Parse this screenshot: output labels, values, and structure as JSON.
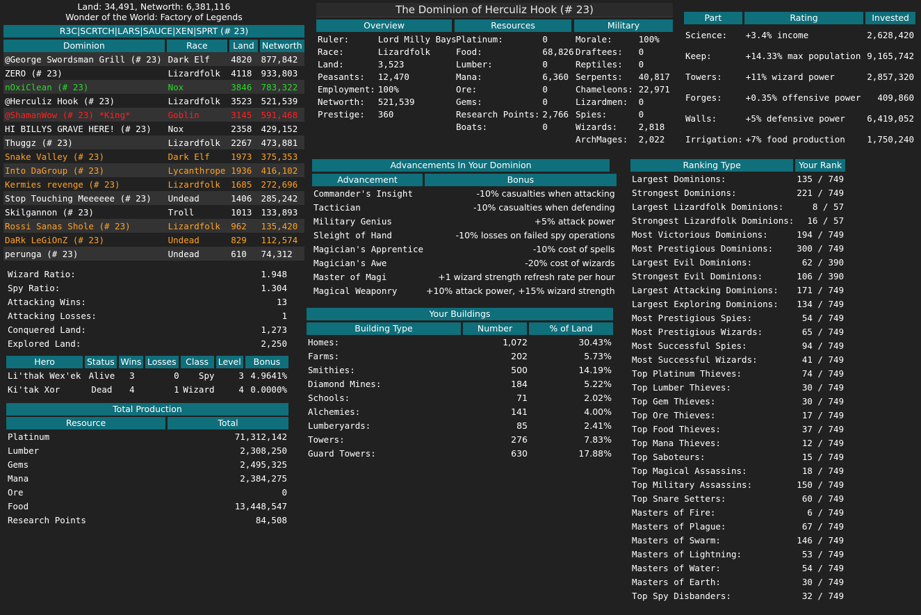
{
  "top": {
    "land_line": "Land: 34,491, Networth: 6,381,116",
    "wonder_line": "Wonder of the World: Factory of Legends"
  },
  "realm": {
    "title": "R3C|SCRTCH|LARS|SAUCE|XEN|SPRT (# 23)",
    "columns": [
      "Dominion",
      "Race",
      "Land",
      "Networth"
    ],
    "rows": [
      {
        "name": "@George Swordsman Grill  (# 23)",
        "race": "Dark Elf",
        "land": "4820",
        "networth": "877,842",
        "color": "white"
      },
      {
        "name": "ZERO  (# 23)",
        "race": "Lizardfolk",
        "land": "4118",
        "networth": "933,803",
        "color": "white"
      },
      {
        "name": "nOxiClean  (# 23)",
        "race": "Nox",
        "land": "3846",
        "networth": "783,322",
        "color": "green"
      },
      {
        "name": "@Herculiz Hook  (# 23)",
        "race": "Lizardfolk",
        "land": "3523",
        "networth": "521,539",
        "color": "white"
      },
      {
        "name": "@ShamanWow  (# 23) *King*",
        "race": "Goblin",
        "land": "3145",
        "networth": "591,468",
        "color": "red"
      },
      {
        "name": "HI BILLYS GRAVE HERE!  (# 23)",
        "race": "Nox",
        "land": "2358",
        "networth": "429,152",
        "color": "white"
      },
      {
        "name": "Thuggz  (# 23)",
        "race": "Lizardfolk",
        "land": "2267",
        "networth": "473,881",
        "color": "white"
      },
      {
        "name": "Snake Valley  (# 23)",
        "race": "Dark Elf",
        "land": "1973",
        "networth": "375,353",
        "color": "orange"
      },
      {
        "name": "Into DaGroup  (# 23)",
        "race": "Lycanthrope",
        "land": "1936",
        "networth": "416,102",
        "color": "orange"
      },
      {
        "name": "Kermies revenge  (# 23)",
        "race": "Lizardfolk",
        "land": "1685",
        "networth": "272,696",
        "color": "orange"
      },
      {
        "name": "Stop Touching Meeeeee  (# 23)",
        "race": "Undead",
        "land": "1406",
        "networth": "285,242",
        "color": "white"
      },
      {
        "name": "Skilgannon  (# 23)",
        "race": "Troll",
        "land": "1013",
        "networth": "133,893",
        "color": "white"
      },
      {
        "name": "Rossi Sanas Shole  (# 23)",
        "race": "Lizardfolk",
        "land": "962",
        "networth": "135,420",
        "color": "orange"
      },
      {
        "name": "DaRk LeGiOnZ  (# 23)",
        "race": "Undead",
        "land": "829",
        "networth": "112,574",
        "color": "orange"
      },
      {
        "name": "perunga  (# 23)",
        "race": "Undead",
        "land": "610",
        "networth": "74,312",
        "color": "white"
      }
    ]
  },
  "ratios": [
    {
      "label": "Wizard Ratio:",
      "value": "1.948"
    },
    {
      "label": "Spy Ratio:",
      "value": "1.304"
    },
    {
      "label": "Attacking Wins:",
      "value": "13"
    },
    {
      "label": "Attacking Losses:",
      "value": "1"
    },
    {
      "label": "Conquered Land:",
      "value": "1,273"
    },
    {
      "label": "Explored Land:",
      "value": "2,250"
    }
  ],
  "heroes": {
    "columns": [
      "Hero",
      "Status",
      "Wins",
      "Losses",
      "Class",
      "Level",
      "Bonus"
    ],
    "rows": [
      {
        "hero": "Li'thak Wex'ek",
        "status": "Alive",
        "wins": "3",
        "losses": "0",
        "class": "Spy",
        "level": "3",
        "bonus": "4.9641%"
      },
      {
        "hero": "Ki'tak Xor",
        "status": "Dead",
        "wins": "4",
        "losses": "1",
        "class": "Wizard",
        "level": "4",
        "bonus": "0.0000%"
      }
    ]
  },
  "production": {
    "title": "Total Production",
    "columns": [
      "Resource",
      "Total"
    ],
    "rows": [
      {
        "resource": "Platinum",
        "total": "71,312,142"
      },
      {
        "resource": "Lumber",
        "total": "2,308,250"
      },
      {
        "resource": "Gems",
        "total": "2,495,325"
      },
      {
        "resource": "Mana",
        "total": "2,384,275"
      },
      {
        "resource": "Ore",
        "total": "0"
      },
      {
        "resource": "Food",
        "total": "13,448,547"
      },
      {
        "resource": "Research Points",
        "total": "84,508"
      }
    ]
  },
  "dominion": {
    "title": "The Dominion of Herculiz Hook (# 23)",
    "overview_label": "Overview",
    "resources_label": "Resources",
    "military_label": "Military",
    "overview": [
      {
        "label": "Ruler:",
        "value": "Lord Milly Bays"
      },
      {
        "label": "Race:",
        "value": "Lizardfolk"
      },
      {
        "label": "Land:",
        "value": "3,523"
      },
      {
        "label": "Peasants:",
        "value": "12,470"
      },
      {
        "label": "Employment:",
        "value": "100%"
      },
      {
        "label": "Networth:",
        "value": "521,539"
      },
      {
        "label": "Prestige:",
        "value": "360"
      }
    ],
    "resources": [
      {
        "label": "Platinum:",
        "value": "0"
      },
      {
        "label": "Food:",
        "value": "68,826"
      },
      {
        "label": "Lumber:",
        "value": "0"
      },
      {
        "label": "Mana:",
        "value": "6,360"
      },
      {
        "label": "Ore:",
        "value": "0"
      },
      {
        "label": "Gems:",
        "value": "0"
      },
      {
        "label": "Research Points:",
        "value": "2,766"
      },
      {
        "label": "Boats:",
        "value": "0"
      }
    ],
    "military": [
      {
        "label": "Morale:",
        "value": "100%"
      },
      {
        "label": "Draftees:",
        "value": "0"
      },
      {
        "label": "Reptiles:",
        "value": "0"
      },
      {
        "label": "Serpents:",
        "value": "40,817"
      },
      {
        "label": "Chameleons:",
        "value": "22,971"
      },
      {
        "label": "Lizardmen:",
        "value": "0"
      },
      {
        "label": "Spies:",
        "value": "0"
      },
      {
        "label": "Wizards:",
        "value": "2,818"
      },
      {
        "label": "ArchMages:",
        "value": "2,022"
      }
    ]
  },
  "improvements": {
    "columns": [
      "Part",
      "Rating",
      "Invested"
    ],
    "rows": [
      {
        "part": "Science:",
        "rating": "+3.4% income",
        "invested": "2,628,420"
      },
      {
        "part": "Keep:",
        "rating": "+14.33% max population",
        "invested": "9,165,742"
      },
      {
        "part": "Towers:",
        "rating": "+11% wizard power",
        "invested": "2,857,320"
      },
      {
        "part": "Forges:",
        "rating": "+0.35% offensive power",
        "invested": "409,860"
      },
      {
        "part": "Walls:",
        "rating": "+5% defensive power",
        "invested": "6,419,052"
      },
      {
        "part": "Irrigation:",
        "rating": "+7% food production",
        "invested": "1,750,240"
      }
    ]
  },
  "advancements": {
    "title": "Advancements In Your Dominion",
    "columns": [
      "Advancement",
      "Bonus"
    ],
    "rows": [
      {
        "name": "Commander's Insight",
        "bonus": "-10% casualties when attacking"
      },
      {
        "name": "Tactician",
        "bonus": "-10% casualties when defending"
      },
      {
        "name": "Military Genius",
        "bonus": "+5% attack power"
      },
      {
        "name": "Sleight of Hand",
        "bonus": "-10% losses on failed spy operations"
      },
      {
        "name": "Magician's Apprentice",
        "bonus": "-10% cost of spells"
      },
      {
        "name": "Magician's Awe",
        "bonus": "-20% cost of wizards"
      },
      {
        "name": "Master of Magi",
        "bonus": "+1 wizard strength refresh rate per hour"
      },
      {
        "name": "Magical Weaponry",
        "bonus": "+10% attack power, +15% wizard strength"
      }
    ]
  },
  "buildings": {
    "title": "Your Buildings",
    "columns": [
      "Building Type",
      "Number",
      "% of Land"
    ],
    "rows": [
      {
        "type": "Homes:",
        "number": "1,072",
        "pct": "30.43%"
      },
      {
        "type": "Farms:",
        "number": "202",
        "pct": "5.73%"
      },
      {
        "type": "Smithies:",
        "number": "500",
        "pct": "14.19%"
      },
      {
        "type": "Diamond Mines:",
        "number": "184",
        "pct": "5.22%"
      },
      {
        "type": "Schools:",
        "number": "71",
        "pct": "2.02%"
      },
      {
        "type": "Alchemies:",
        "number": "141",
        "pct": "4.00%"
      },
      {
        "type": "Lumberyards:",
        "number": "85",
        "pct": "2.41%"
      },
      {
        "type": "Towers:",
        "number": "276",
        "pct": "7.83%"
      },
      {
        "type": "Guard Towers:",
        "number": "630",
        "pct": "17.88%"
      }
    ]
  },
  "rankings": {
    "columns": [
      "Ranking Type",
      "Your Rank"
    ],
    "rows": [
      {
        "type": "Largest Dominions:",
        "rank": "135 / 749"
      },
      {
        "type": "Strongest Dominions:",
        "rank": "221 / 749"
      },
      {
        "type": "Largest Lizardfolk Dominions:",
        "rank": "8 / 57"
      },
      {
        "type": "Strongest Lizardfolk Dominions:",
        "rank": "16 / 57"
      },
      {
        "type": "Most Victorious Dominions:",
        "rank": "194 / 749"
      },
      {
        "type": "Most Prestigious Dominions:",
        "rank": "300 / 749"
      },
      {
        "type": "Largest Evil Dominions:",
        "rank": "62 / 390"
      },
      {
        "type": "Strongest Evil Dominions:",
        "rank": "106 / 390"
      },
      {
        "type": "Largest Attacking Dominions:",
        "rank": "171 / 749"
      },
      {
        "type": "Largest Exploring Dominions:",
        "rank": "134 / 749"
      },
      {
        "type": "Most Prestigious Spies:",
        "rank": "54 / 749"
      },
      {
        "type": "Most Prestigious Wizards:",
        "rank": "65 / 749"
      },
      {
        "type": "Most Successful Spies:",
        "rank": "94 / 749"
      },
      {
        "type": "Most Successful Wizards:",
        "rank": "41 / 749"
      },
      {
        "type": "Top Platinum Thieves:",
        "rank": "74 / 749"
      },
      {
        "type": "Top Lumber Thieves:",
        "rank": "30 / 749"
      },
      {
        "type": "Top Gem Thieves:",
        "rank": "30 / 749"
      },
      {
        "type": "Top Ore Thieves:",
        "rank": "17 / 749"
      },
      {
        "type": "Top Food Thieves:",
        "rank": "37 / 749"
      },
      {
        "type": "Top Mana Thieves:",
        "rank": "12 / 749"
      },
      {
        "type": "Top Saboteurs:",
        "rank": "15 / 749"
      },
      {
        "type": "Top Magical Assassins:",
        "rank": "18 / 749"
      },
      {
        "type": "Top Military Assassins:",
        "rank": "150 / 749"
      },
      {
        "type": "Top Snare Setters:",
        "rank": "60 / 749"
      },
      {
        "type": "Masters of Fire:",
        "rank": "6 / 749"
      },
      {
        "type": "Masters of Plague:",
        "rank": "67 / 749"
      },
      {
        "type": "Masters of Swarm:",
        "rank": "146 / 749"
      },
      {
        "type": "Masters of Lightning:",
        "rank": "53 / 749"
      },
      {
        "type": "Masters of Water:",
        "rank": "54 / 749"
      },
      {
        "type": "Masters of Earth:",
        "rank": "30 / 749"
      },
      {
        "type": "Top Spy Disbanders:",
        "rank": "32 / 749"
      }
    ]
  }
}
